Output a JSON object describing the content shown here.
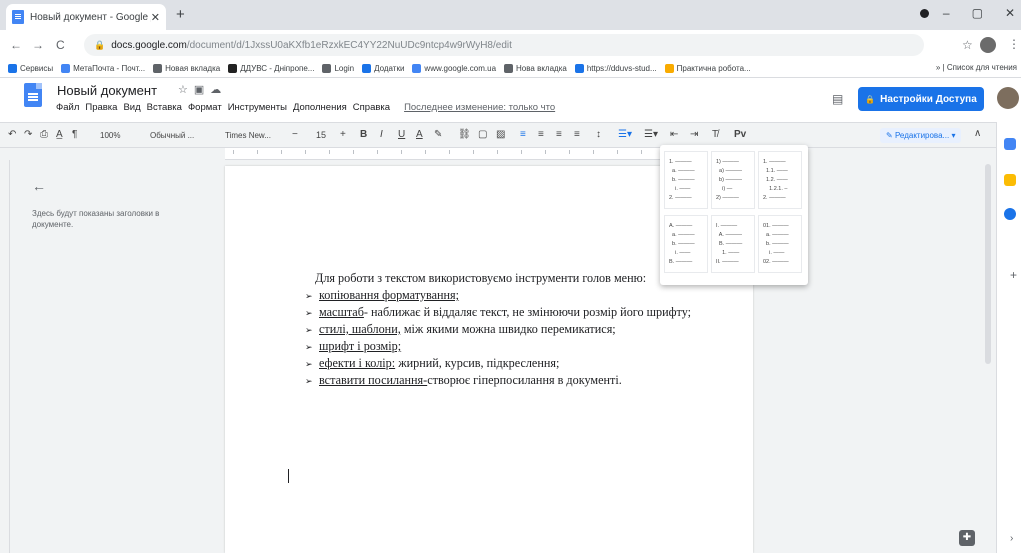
{
  "browser": {
    "tab_title": "Новый документ - Google Доку",
    "tab_close": "✕",
    "new_tab": "+",
    "url_host": "docs.google.com",
    "url_path": "/document/d/1JxssU0aKXfb1eRzxkEC4YY22NuUDc9ntcp4w9rWyH8/edit",
    "window_controls": [
      "–",
      "▢",
      "✕"
    ],
    "bookmarks": [
      {
        "label": "Сервисы",
        "color": "#1a73e8"
      },
      {
        "label": "МетаПочта - Почт...",
        "color": "#4285f4"
      },
      {
        "label": "Новая вкладка",
        "color": "#5f6368"
      },
      {
        "label": "ДДУВС - Дніпропе...",
        "color": "#222"
      },
      {
        "label": "Login",
        "color": "#5f6368"
      },
      {
        "label": "Додатки",
        "color": "#1a73e8"
      },
      {
        "label": "www.google.com.ua",
        "color": "#4285f4"
      },
      {
        "label": "Нова вкладка",
        "color": "#5f6368"
      },
      {
        "label": "https://dduvs-stud...",
        "color": "#1a73e8"
      },
      {
        "label": "Практична робота...",
        "color": "#f9ab00"
      }
    ],
    "reading_list": "»  |  Список для чтения"
  },
  "docs": {
    "title": "Новый документ",
    "menu": [
      "Файл",
      "Правка",
      "Вид",
      "Вставка",
      "Формат",
      "Инструменты",
      "Дополнения",
      "Справка"
    ],
    "last_edit": "Последнее изменение: только что",
    "share_label": "Настройки Доступа",
    "toolbar": {
      "zoom": "100%",
      "style": "Обычный ...",
      "font": "Times New...",
      "minus": "−",
      "size": "15",
      "plus": "+",
      "bold": "B",
      "italic": "I",
      "underline": "U",
      "color": "A",
      "edit_mode": "Редактирова..."
    },
    "outline_hint": "Здесь будут показаны заголовки в документе.",
    "body": {
      "paragraph": "Для роботи з текстом використовуємо інструменти голов меню:",
      "items": [
        {
          "link": "копіювання форматування;",
          "rest": ""
        },
        {
          "link": "масштаб",
          "rest": "- наближає й віддаляє текст, не змінюючи розмір його шрифту;"
        },
        {
          "link": "стилі, шаблони,",
          "rest": " між якими можна швидко перемикатися;"
        },
        {
          "link": "шрифт і розмір;",
          "rest": ""
        },
        {
          "link": "ефекти і колір:",
          "rest": " жирний, курсив, підкреслення;"
        },
        {
          "link": "вставити посилання-",
          "rest": "створює гіперпосилання в документі."
        }
      ]
    },
    "list_menu": {
      "options": [
        "1. ———\n  a. ———\n  b. ———\n    i. ——\n2. ———",
        "1) ———\n  a) ———\n  b) ———\n    i) —\n2) ———",
        "1. ———\n  1.1. ——\n  1.2. ——\n    1.2.1. –\n2. ———",
        "A. ———\n  a. ———\n  b. ———\n    i. ——\nB. ———",
        "I. ———\n  A. ———\n  B. ———\n    1. ——\nII. ———",
        "01. ———\n  a. ———\n  b. ———\n    i. ——\n02. ———"
      ]
    }
  }
}
